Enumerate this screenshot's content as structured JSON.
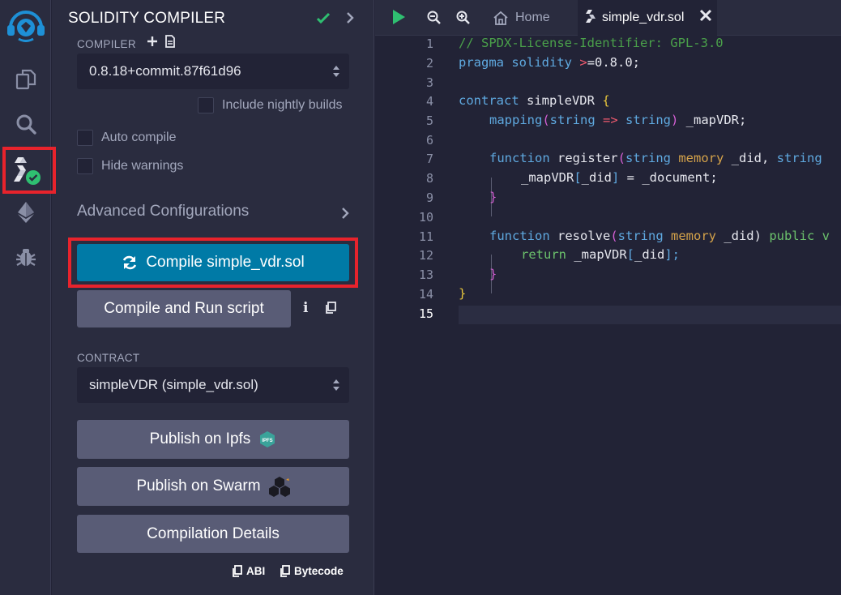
{
  "rail": {
    "items": [
      "remix-logo-icon",
      "file-explorer-icon",
      "search-icon",
      "solidity-compiler-icon",
      "deploy-run-icon",
      "debugger-icon"
    ]
  },
  "panel": {
    "title": "SOLIDITY COMPILER",
    "compiler_label": "COMPILER",
    "compiler_version": "0.8.18+commit.87f61d96",
    "include_nightly": "Include nightly builds",
    "auto_compile": "Auto compile",
    "hide_warnings": "Hide warnings",
    "advanced": "Advanced Configurations",
    "compile_button": "Compile simple_vdr.sol",
    "run_script_button": "Compile and Run script",
    "contract_label": "CONTRACT",
    "contract_value": "simpleVDR (simple_vdr.sol)",
    "publish_ipfs": "Publish on Ipfs",
    "ipfs_badge": "IPFS",
    "publish_swarm": "Publish on Swarm",
    "compilation_details": "Compilation Details",
    "abi_link": "ABI",
    "bytecode_link": "Bytecode"
  },
  "editor": {
    "tabs": [
      {
        "label": "Home"
      },
      {
        "label": "simple_vdr.sol"
      }
    ],
    "line_numbers": [
      "1",
      "2",
      "3",
      "4",
      "5",
      "6",
      "7",
      "8",
      "9",
      "10",
      "11",
      "12",
      "13",
      "14",
      "15"
    ],
    "current_line": "15",
    "code": {
      "l1": "// SPDX-License-Identifier: GPL-3.0",
      "l2_a": "pragma",
      "l2_b": "solidity",
      "l2_c": ">",
      "l2_d": "=0.8.0;",
      "l4_a": "contract",
      "l4_b": " simpleVDR ",
      "l4_c": "{",
      "l5_a": "mapping",
      "l5_b": "(",
      "l5_c": "string",
      "l5_d": " => ",
      "l5_e": "string",
      "l5_f": ")",
      "l5_g": " _mapVDR;",
      "l7_a": "function",
      "l7_b": " register",
      "l7_c": "(",
      "l7_d": "string",
      "l7_e": " memory",
      "l7_f": " _did, ",
      "l7_g": "string",
      "l8_a": "_mapVDR",
      "l8_b": "[",
      "l8_c": "_did",
      "l8_d": "]",
      "l8_e": " = _document;",
      "l9": "}",
      "l11_a": "function",
      "l11_b": " resolve",
      "l11_c": "(",
      "l11_d": "string",
      "l11_e": " memory",
      "l11_f": " _did)",
      "l11_g": " public v",
      "l12_a": "return",
      "l12_b": " _mapVDR",
      "l12_c": "[",
      "l12_d": "_did",
      "l12_e": "];",
      "l13": "}",
      "l14": "}"
    }
  },
  "colors": {
    "accent": "#007aa6",
    "highlight": "#e8232c",
    "success": "#2fbf71"
  }
}
